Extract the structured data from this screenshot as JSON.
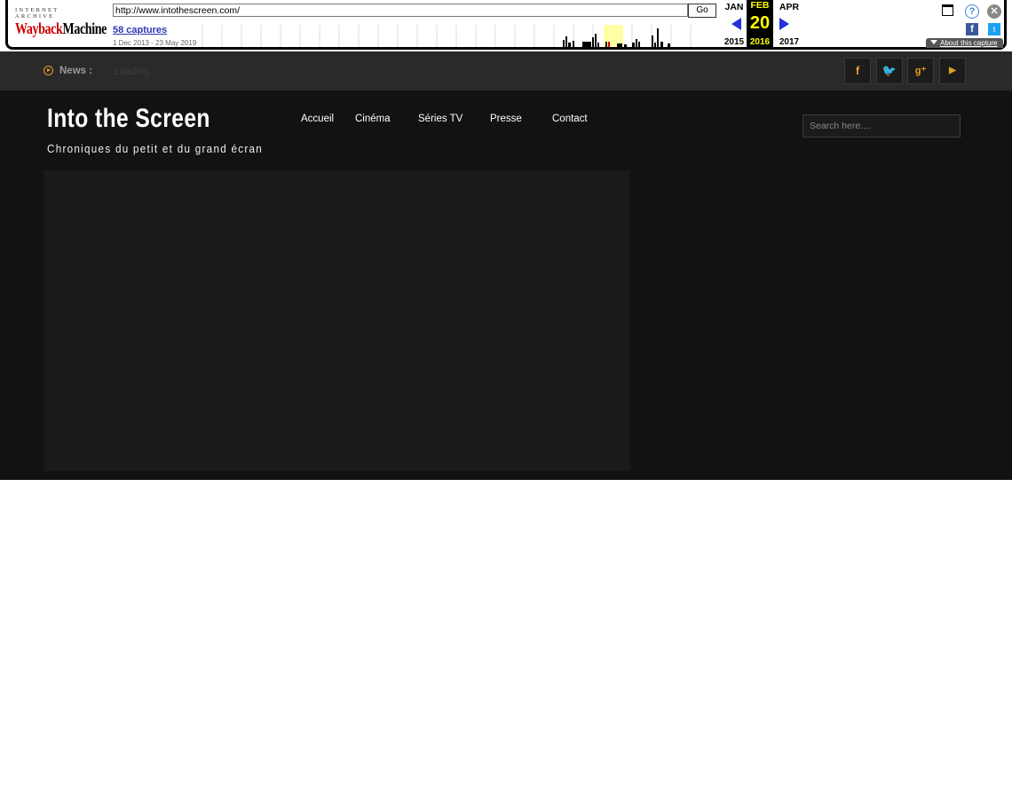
{
  "wayback": {
    "logo_top": "INTERNET ARCHIVE",
    "logo_wayback": "Wayback",
    "logo_machine": "Machine",
    "url": "http://www.intothescreen.com/",
    "go_label": "Go",
    "captures_label": "58 captures",
    "date_range": "1 Dec 2013 - 23 May 2019",
    "months": {
      "prev": "JAN",
      "current": "FEB",
      "next": "APR"
    },
    "day": "20",
    "years": {
      "prev": "2015",
      "current": "2016",
      "next": "2017"
    },
    "about_label": "About this capture",
    "icons": [
      "window-icon",
      "help-icon",
      "close-icon",
      "facebook-icon",
      "twitter-icon"
    ]
  },
  "site": {
    "news_label": "News :",
    "news_ticker": "Loading...",
    "social": [
      "facebook-icon",
      "twitter-icon",
      "google-plus-icon",
      "youtube-icon"
    ],
    "title": "Into the Screen",
    "tagline": "Chroniques du petit et du grand écran",
    "nav": [
      "Accueil",
      "Cinéma",
      "Séries TV",
      "Presse",
      "Contact"
    ],
    "search_placeholder": "Search here....",
    "accent": "#e2a020",
    "background": "#121212"
  }
}
